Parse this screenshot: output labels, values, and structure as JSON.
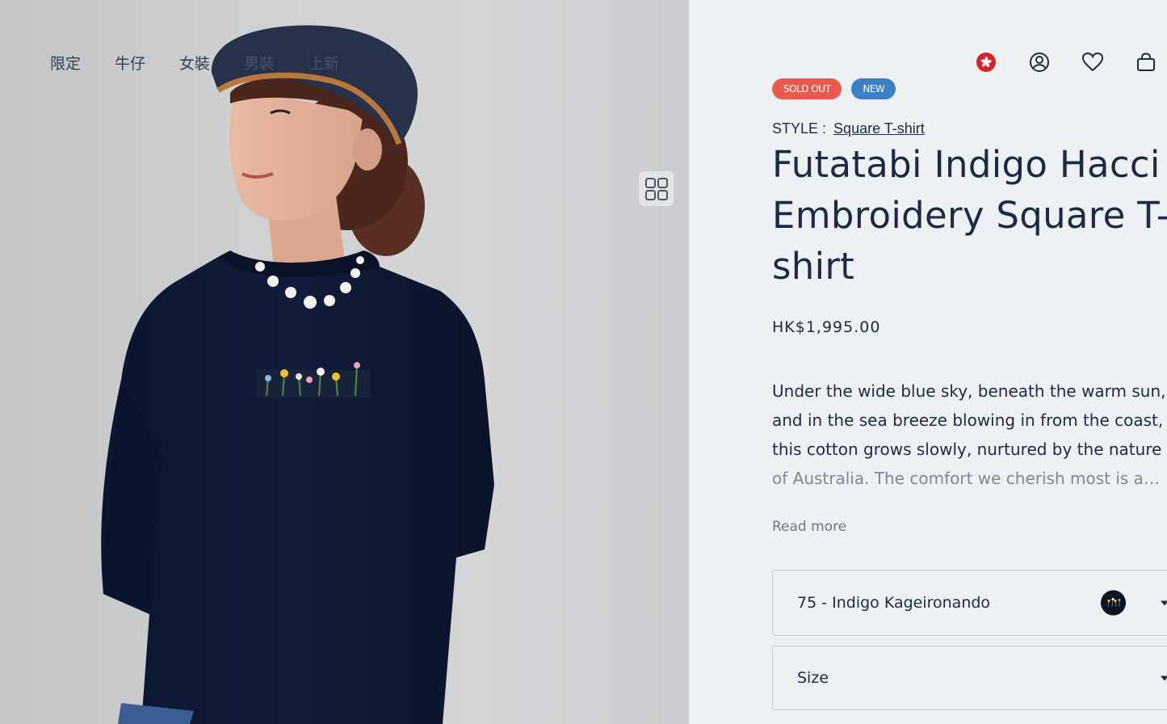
{
  "nav": {
    "items": [
      {
        "label": "限定",
        "faded": false
      },
      {
        "label": "牛仔",
        "faded": false
      },
      {
        "label": "女裝",
        "faded": false
      },
      {
        "label": "男裝",
        "faded": true
      },
      {
        "label": "上新",
        "faded": true
      }
    ]
  },
  "header": {
    "icons": [
      "hong-kong-flag-icon",
      "account-icon",
      "wishlist-heart-icon",
      "cart-bag-icon"
    ]
  },
  "product": {
    "badges": {
      "sold_out": "SOLD OUT",
      "new": "NEW"
    },
    "style_label": "STYLE :",
    "style_value": "Square T-shirt",
    "title": "Futatabi Indigo Hacci Embroidery Square T-shirt",
    "price": "HK$1,995.00",
    "description_lines": [
      "Under the wide blue sky, beneath the warm sun,",
      "and in the sea breeze blowing in from the coast,",
      "this cotton grows slowly, nurtured by the nature",
      "of Australia. The comfort we cherish most is a…"
    ],
    "read_more": "Read more",
    "color_select": "75 - Indigo Kageironando",
    "size_select": "Size"
  },
  "colors": {
    "text": "#1c2a44",
    "sold_out_badge": "#e85a4f",
    "new_badge": "#3b7fc4",
    "panel_bg": "#eef1f3",
    "flag_red": "#d6232b"
  }
}
